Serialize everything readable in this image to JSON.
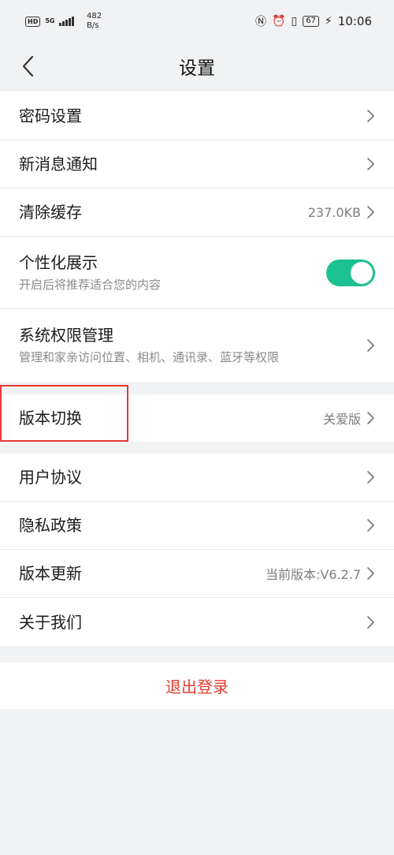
{
  "status_bar": {
    "hd": "HD",
    "network": "5G",
    "speed_value": "482",
    "speed_unit": "B/s",
    "battery": "67",
    "time": "10:06",
    "icons": [
      "nfc-icon",
      "alarm-icon",
      "vibrate-icon",
      "charging-icon"
    ]
  },
  "nav": {
    "title": "设置",
    "back_icon": "chevron-left-icon"
  },
  "group1": [
    {
      "label": "密码设置"
    },
    {
      "label": "新消息通知"
    },
    {
      "label": "清除缓存",
      "value": "237.0KB"
    },
    {
      "label": "个性化展示",
      "subtitle": "开启后将推荐适合您的内容",
      "toggle_on": true,
      "toggle_color": "#1bc191"
    },
    {
      "label": "系统权限管理",
      "subtitle": "管理和家亲访问位置、相机、通讯录、蓝牙等权限"
    }
  ],
  "group2": [
    {
      "label": "版本切换",
      "value": "关爱版"
    }
  ],
  "group3": [
    {
      "label": "用户协议"
    },
    {
      "label": "隐私政策"
    },
    {
      "label": "版本更新",
      "value": "当前版本:V6.2.7"
    },
    {
      "label": "关于我们"
    }
  ],
  "logout": {
    "label": "退出登录",
    "color": "#e53b2f"
  },
  "highlight_color": "#e53935"
}
